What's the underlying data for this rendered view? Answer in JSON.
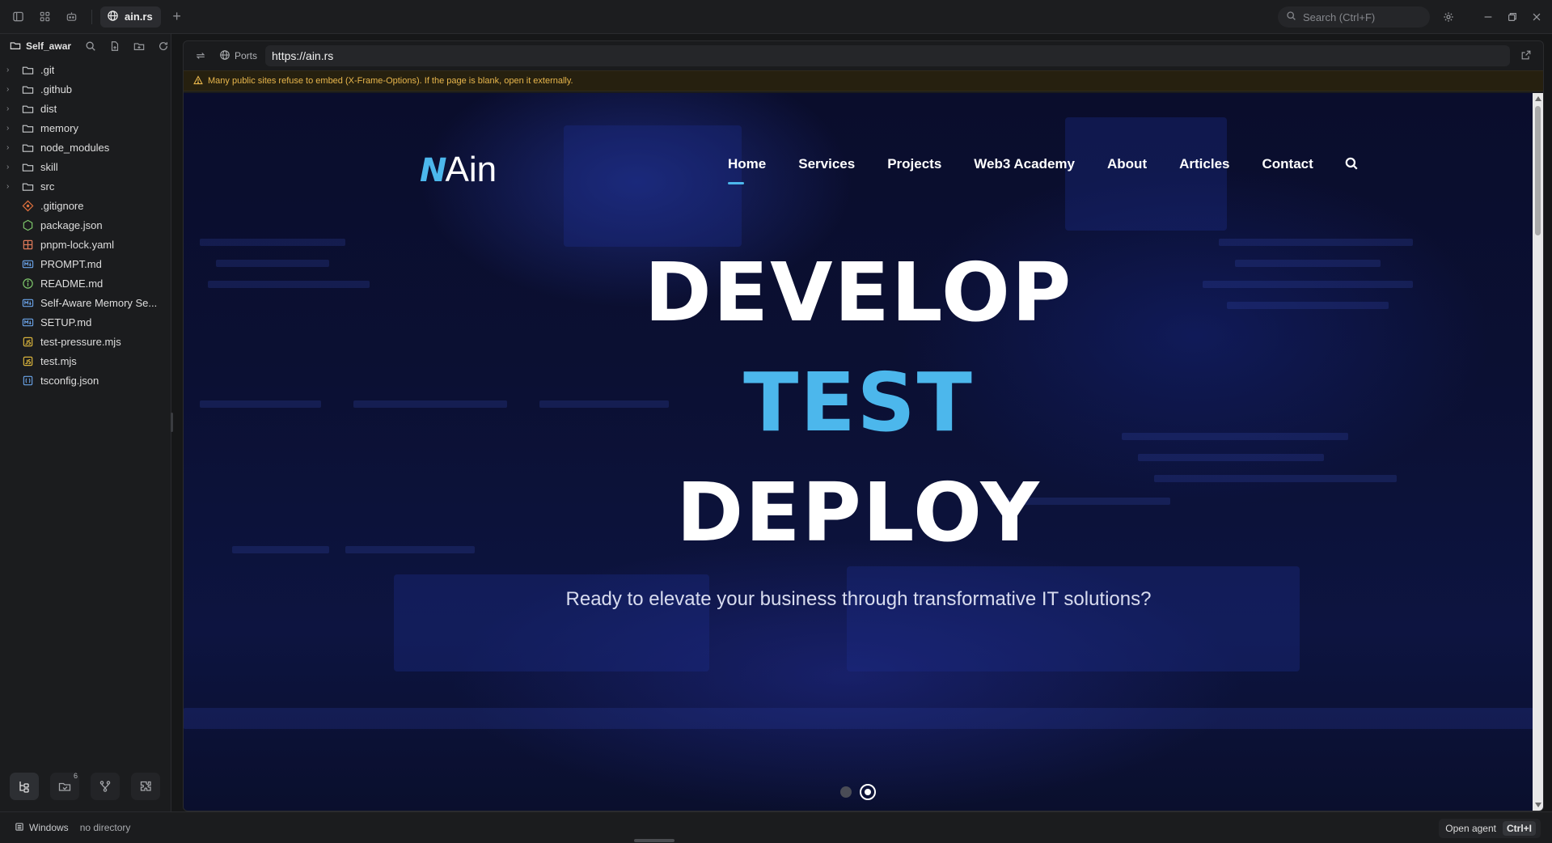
{
  "titlebar": {
    "tab_label": "ain.rs",
    "search_placeholder": "Search (Ctrl+F)"
  },
  "sidebar": {
    "title": "Self_awar",
    "tree": [
      {
        "label": ".git",
        "type": "folder",
        "expandable": true
      },
      {
        "label": ".github",
        "type": "folder",
        "expandable": true
      },
      {
        "label": "dist",
        "type": "folder",
        "expandable": true
      },
      {
        "label": "memory",
        "type": "folder",
        "expandable": true
      },
      {
        "label": "node_modules",
        "type": "folder",
        "expandable": true
      },
      {
        "label": "skill",
        "type": "folder",
        "expandable": true
      },
      {
        "label": "src",
        "type": "folder",
        "expandable": true
      },
      {
        "label": ".gitignore",
        "type": "git-file"
      },
      {
        "label": "package.json",
        "type": "node-file"
      },
      {
        "label": "pnpm-lock.yaml",
        "type": "yaml-file"
      },
      {
        "label": "PROMPT.md",
        "type": "md-file"
      },
      {
        "label": "README.md",
        "type": "info-file"
      },
      {
        "label": "Self-Aware Memory Se...",
        "type": "md-file"
      },
      {
        "label": "SETUP.md",
        "type": "md-file"
      },
      {
        "label": "test-pressure.mjs",
        "type": "js-file"
      },
      {
        "label": "test.mjs",
        "type": "js-file"
      },
      {
        "label": "tsconfig.json",
        "type": "json-file"
      }
    ],
    "badge_count": "6"
  },
  "browser": {
    "ports_label": "Ports",
    "url": "https://ain.rs",
    "warning": "Many public sites refuse to embed (X-Frame-Options). If the page is blank, open it externally."
  },
  "site": {
    "logo_mark": "N",
    "logo_text": "Ain",
    "nav": [
      "Home",
      "Services",
      "Projects",
      "Web3 Academy",
      "About",
      "Articles",
      "Contact"
    ],
    "headline_1": "DEVELOP",
    "headline_2": "TEST",
    "headline_3": "DEPLOY",
    "tagline": "Ready to elevate your business through transformative IT solutions?",
    "slides_total": 2,
    "slide_active": 2
  },
  "statusbar": {
    "platform": "Windows",
    "directory": "no directory",
    "agent_label": "Open agent",
    "agent_shortcut": "Ctrl+I"
  },
  "colors": {
    "accent": "#4cb7ec",
    "warning": "#e8b64c"
  }
}
